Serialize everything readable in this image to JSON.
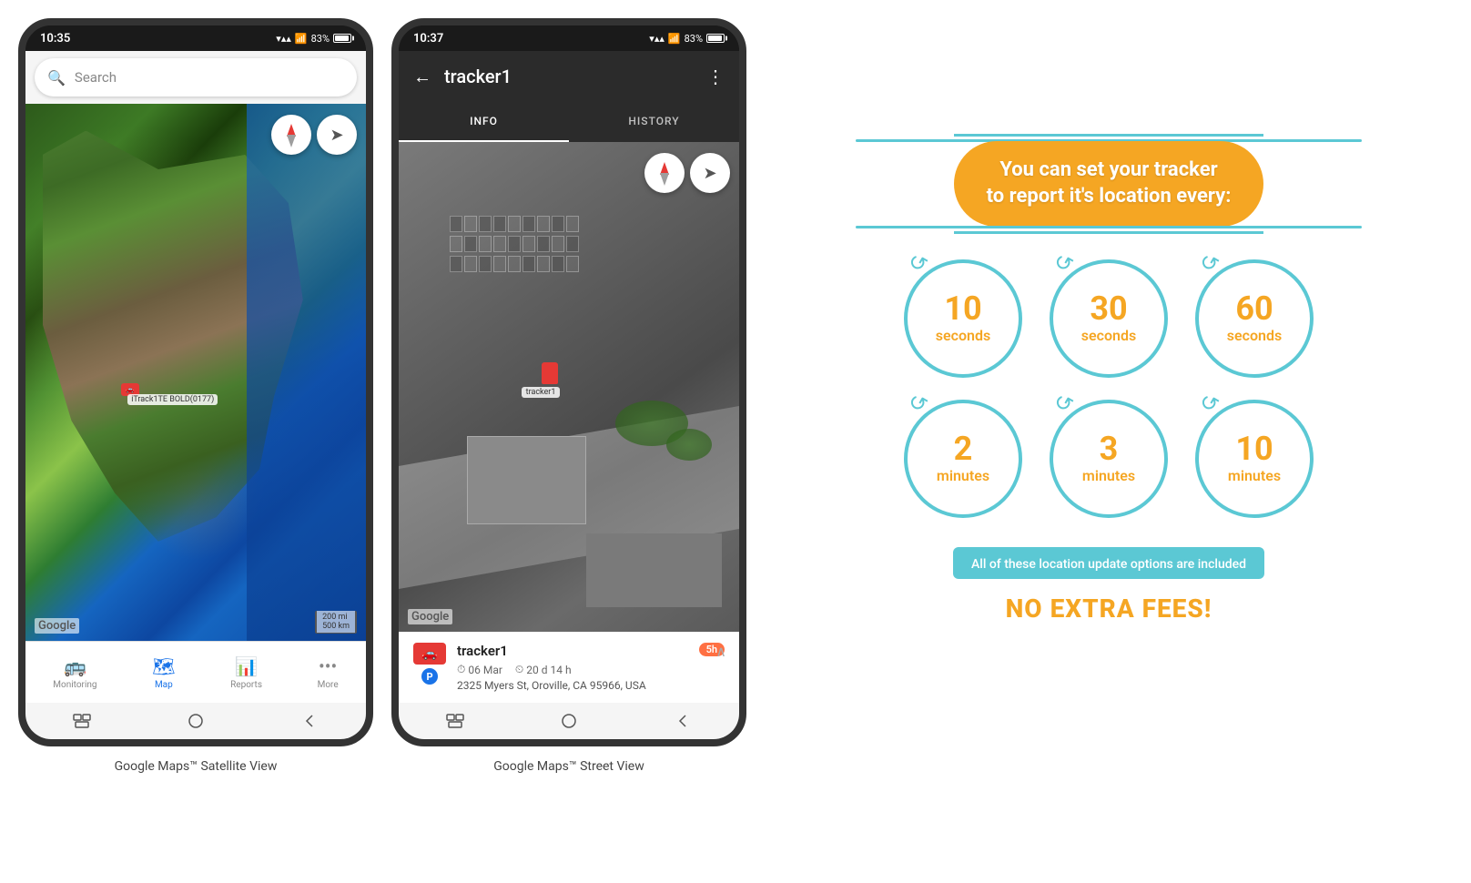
{
  "phone1": {
    "status_time": "10:35",
    "signal": "▾▾▾",
    "battery_pct": "83%",
    "search_placeholder": "Search",
    "compass_label": "compass",
    "car_label": "iTrack1TE BOLD(0177)",
    "google_label": "Google",
    "scale_label": "200 mi\n500 km",
    "nav_items": [
      {
        "icon": "🚌",
        "label": "Monitoring",
        "active": false
      },
      {
        "icon": "🗺",
        "label": "Map",
        "active": true
      },
      {
        "icon": "📊",
        "label": "Reports",
        "active": false
      },
      {
        "icon": "•••",
        "label": "More",
        "active": false
      }
    ],
    "caption": "Google Maps™ Satellite View"
  },
  "phone2": {
    "status_time": "10:37",
    "signal": "▾▾▾",
    "battery_pct": "83%",
    "header_title": "tracker1",
    "tabs": [
      {
        "label": "INFO",
        "active": true
      },
      {
        "label": "HISTORY",
        "active": false
      }
    ],
    "tracker_card": {
      "name": "tracker1",
      "date": "06 Mar",
      "duration": "20 d 14 h",
      "address": "2325 Myers St, Oroville, CA 95966, USA",
      "time_ago": "5h",
      "p_badge": "P"
    },
    "google_label": "Google",
    "caption": "Google Maps™ Street View"
  },
  "info_panel": {
    "title": "You can set your tracker\nto report it's location every:",
    "intervals": [
      {
        "number": "10",
        "unit": "seconds"
      },
      {
        "number": "30",
        "unit": "seconds"
      },
      {
        "number": "60",
        "unit": "seconds"
      },
      {
        "number": "2",
        "unit": "minutes"
      },
      {
        "number": "3",
        "unit": "minutes"
      },
      {
        "number": "10",
        "unit": "minutes"
      }
    ],
    "notice": "All of these location update options are included",
    "no_extra_fees": "NO EXTRA FEES!"
  }
}
